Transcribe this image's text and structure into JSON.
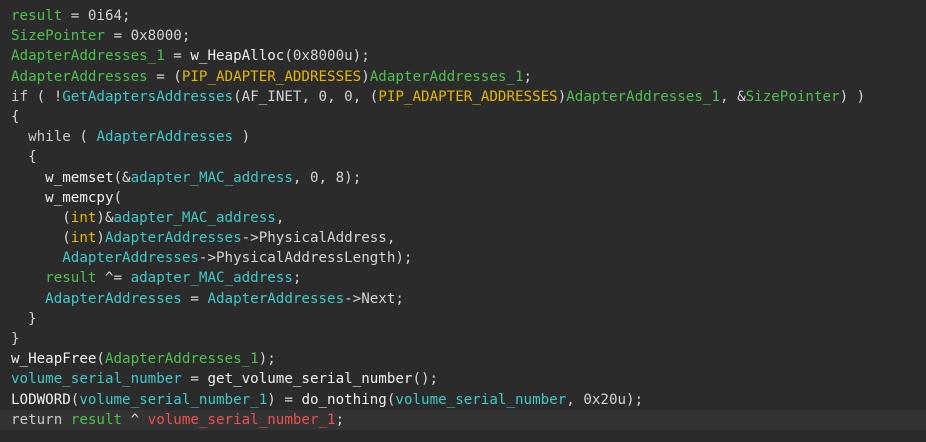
{
  "colors": {
    "background": "#2b2b2b",
    "default_text": "#d4d4d4",
    "local_variable": "#4ec04e",
    "global_variable": "#3fc9c9",
    "function": "#f0f0f0",
    "type": "#e6b800",
    "stack_variable": "#f05050",
    "keyword": "#c8c8c8"
  },
  "code_lines": [
    {
      "tokens": [
        {
          "t": "result",
          "c": "local_variable"
        },
        {
          "t": " = 0i64;",
          "c": "default_text"
        }
      ]
    },
    {
      "tokens": [
        {
          "t": "SizePointer",
          "c": "local_variable"
        },
        {
          "t": " = 0x8000;",
          "c": "default_text"
        }
      ]
    },
    {
      "tokens": [
        {
          "t": "AdapterAddresses_1",
          "c": "local_variable"
        },
        {
          "t": " = ",
          "c": "default_text"
        },
        {
          "t": "w_HeapAlloc",
          "c": "function"
        },
        {
          "t": "(0x8000u);",
          "c": "default_text"
        }
      ]
    },
    {
      "tokens": [
        {
          "t": "AdapterAddresses",
          "c": "local_variable"
        },
        {
          "t": " = (",
          "c": "default_text"
        },
        {
          "t": "PIP_ADAPTER_ADDRESSES",
          "c": "type"
        },
        {
          "t": ")",
          "c": "default_text"
        },
        {
          "t": "AdapterAddresses_1",
          "c": "local_variable"
        },
        {
          "t": ";",
          "c": "default_text"
        }
      ]
    },
    {
      "tokens": [
        {
          "t": "if",
          "c": "keyword"
        },
        {
          "t": " ( !",
          "c": "default_text"
        },
        {
          "t": "GetAdaptersAddresses",
          "c": "global_variable"
        },
        {
          "t": "(AF_INET, 0, 0, (",
          "c": "default_text"
        },
        {
          "t": "PIP_ADAPTER_ADDRESSES",
          "c": "type"
        },
        {
          "t": ")",
          "c": "default_text"
        },
        {
          "t": "AdapterAddresses_1",
          "c": "local_variable"
        },
        {
          "t": ", &",
          "c": "default_text"
        },
        {
          "t": "SizePointer",
          "c": "local_variable"
        },
        {
          "t": ") )",
          "c": "default_text"
        }
      ]
    },
    {
      "tokens": [
        {
          "t": "{",
          "c": "default_text"
        }
      ]
    },
    {
      "tokens": [
        {
          "t": "  ",
          "c": "default_text"
        },
        {
          "t": "while",
          "c": "keyword"
        },
        {
          "t": " ( ",
          "c": "default_text"
        },
        {
          "t": "AdapterAddresses",
          "c": "global_variable"
        },
        {
          "t": " )",
          "c": "default_text"
        }
      ]
    },
    {
      "tokens": [
        {
          "t": "  {",
          "c": "default_text"
        }
      ]
    },
    {
      "tokens": [
        {
          "t": "    ",
          "c": "default_text"
        },
        {
          "t": "w_memset",
          "c": "function"
        },
        {
          "t": "(&",
          "c": "default_text"
        },
        {
          "t": "adapter_MAC_address",
          "c": "global_variable"
        },
        {
          "t": ", 0, 8);",
          "c": "default_text"
        }
      ]
    },
    {
      "tokens": [
        {
          "t": "    ",
          "c": "default_text"
        },
        {
          "t": "w_memcpy",
          "c": "function"
        },
        {
          "t": "(",
          "c": "default_text"
        }
      ]
    },
    {
      "tokens": [
        {
          "t": "      (",
          "c": "default_text"
        },
        {
          "t": "int",
          "c": "type"
        },
        {
          "t": ")&",
          "c": "default_text"
        },
        {
          "t": "adapter_MAC_address",
          "c": "global_variable"
        },
        {
          "t": ",",
          "c": "default_text"
        }
      ]
    },
    {
      "tokens": [
        {
          "t": "      (",
          "c": "default_text"
        },
        {
          "t": "int",
          "c": "type"
        },
        {
          "t": ")",
          "c": "default_text"
        },
        {
          "t": "AdapterAddresses",
          "c": "global_variable"
        },
        {
          "t": "->PhysicalAddress,",
          "c": "default_text"
        }
      ]
    },
    {
      "tokens": [
        {
          "t": "      ",
          "c": "default_text"
        },
        {
          "t": "AdapterAddresses",
          "c": "global_variable"
        },
        {
          "t": "->PhysicalAddressLength);",
          "c": "default_text"
        }
      ]
    },
    {
      "tokens": [
        {
          "t": "    ",
          "c": "default_text"
        },
        {
          "t": "result",
          "c": "local_variable"
        },
        {
          "t": " ^= ",
          "c": "default_text"
        },
        {
          "t": "adapter_MAC_address",
          "c": "global_variable"
        },
        {
          "t": ";",
          "c": "default_text"
        }
      ]
    },
    {
      "tokens": [
        {
          "t": "    ",
          "c": "default_text"
        },
        {
          "t": "AdapterAddresses",
          "c": "global_variable"
        },
        {
          "t": " = ",
          "c": "default_text"
        },
        {
          "t": "AdapterAddresses",
          "c": "global_variable"
        },
        {
          "t": "->Next;",
          "c": "default_text"
        }
      ]
    },
    {
      "tokens": [
        {
          "t": "  }",
          "c": "default_text"
        }
      ]
    },
    {
      "tokens": [
        {
          "t": "}",
          "c": "default_text"
        }
      ]
    },
    {
      "tokens": [
        {
          "t": "w_HeapFree",
          "c": "function"
        },
        {
          "t": "(",
          "c": "default_text"
        },
        {
          "t": "AdapterAddresses_1",
          "c": "local_variable"
        },
        {
          "t": ");",
          "c": "default_text"
        }
      ]
    },
    {
      "tokens": [
        {
          "t": "volume_serial_number",
          "c": "global_variable"
        },
        {
          "t": " = ",
          "c": "default_text"
        },
        {
          "t": "get_volume_serial_number",
          "c": "function"
        },
        {
          "t": "();",
          "c": "default_text"
        }
      ]
    },
    {
      "tokens": [
        {
          "t": "LODWORD",
          "c": "function"
        },
        {
          "t": "(",
          "c": "default_text"
        },
        {
          "t": "volume_serial_number_1",
          "c": "global_variable"
        },
        {
          "t": ") = ",
          "c": "default_text"
        },
        {
          "t": "do_nothing",
          "c": "function"
        },
        {
          "t": "(",
          "c": "default_text"
        },
        {
          "t": "volume_serial_number",
          "c": "global_variable"
        },
        {
          "t": ", 0x20u);",
          "c": "default_text"
        }
      ]
    },
    {
      "tokens": [
        {
          "t": "return",
          "c": "keyword"
        },
        {
          "t": " ",
          "c": "default_text"
        },
        {
          "t": "result",
          "c": "local_variable"
        },
        {
          "t": " ^ ",
          "c": "default_text"
        },
        {
          "t": "volume_serial_number_1",
          "c": "stack_variable"
        },
        {
          "t": ";",
          "c": "default_text"
        }
      ]
    }
  ]
}
